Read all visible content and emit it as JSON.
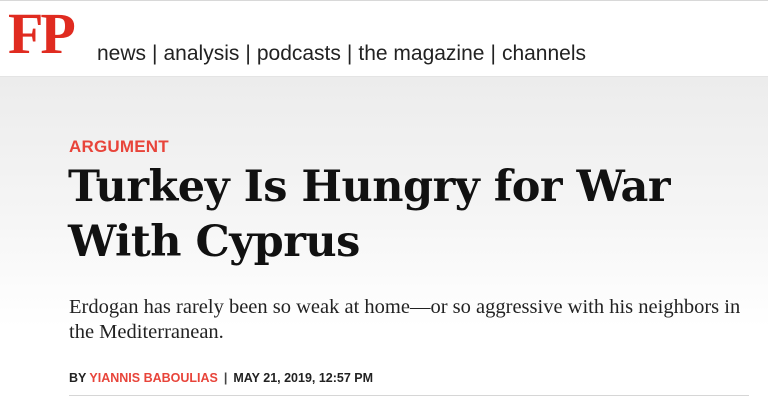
{
  "header": {
    "logo_text": "FP",
    "brand_color": "#e02b20",
    "nav": [
      {
        "label": "news"
      },
      {
        "label": "analysis"
      },
      {
        "label": "podcasts"
      },
      {
        "label": "the magazine"
      },
      {
        "label": "channels"
      }
    ],
    "separator": "|"
  },
  "article": {
    "kicker": "ARGUMENT",
    "kicker_color": "#e8443a",
    "headline": "Turkey Is Hungry for War With Cyprus",
    "dek": "Erdogan has rarely been so weak at home—or so aggressive with his neighbors in the Mediterranean.",
    "byline": {
      "prefix": "BY",
      "author": "YIANNIS BABOULIAS",
      "separator": "|",
      "date": "MAY 21, 2019, 12:57 PM"
    }
  }
}
